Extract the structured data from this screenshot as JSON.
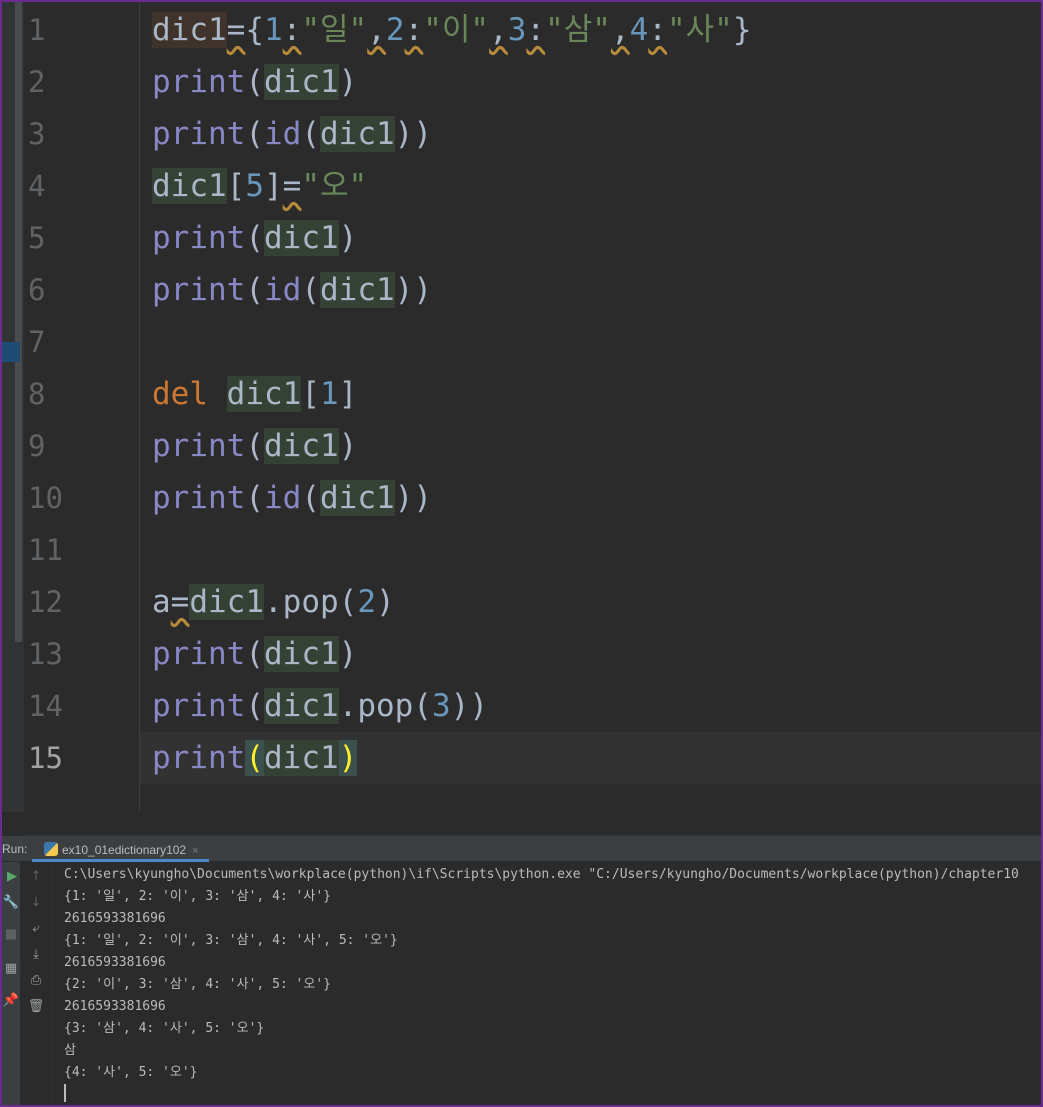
{
  "editor": {
    "line_numbers": [
      "1",
      "2",
      "3",
      "4",
      "5",
      "6",
      "7",
      "8",
      "9",
      "10",
      "11",
      "12",
      "13",
      "14",
      "15"
    ],
    "current_line": "15",
    "lines": [
      {
        "segments": [
          [
            "hl-def",
            "dic1"
          ],
          [
            "warn",
            "="
          ],
          [
            "",
            "{"
          ],
          [
            "num",
            "1"
          ],
          [
            "warn",
            ":"
          ],
          [
            "str",
            "\"일\""
          ],
          [
            "warn",
            ","
          ],
          [
            "num",
            "2"
          ],
          [
            "warn",
            ":"
          ],
          [
            "str",
            "\"이\""
          ],
          [
            "warn",
            ","
          ],
          [
            "num",
            "3"
          ],
          [
            "warn",
            ":"
          ],
          [
            "str",
            "\"삼\""
          ],
          [
            "warn",
            ","
          ],
          [
            "num",
            "4"
          ],
          [
            "warn",
            ":"
          ],
          [
            "str",
            "\"사\""
          ],
          [
            "",
            "}"
          ]
        ]
      },
      {
        "segments": [
          [
            "fn",
            "print"
          ],
          [
            "",
            "("
          ],
          [
            "hl-var",
            "dic1"
          ],
          [
            "",
            ")"
          ]
        ]
      },
      {
        "segments": [
          [
            "fn",
            "print"
          ],
          [
            "",
            "("
          ],
          [
            "fn",
            "id"
          ],
          [
            "",
            "("
          ],
          [
            "hl-var",
            "dic1"
          ],
          [
            "",
            "))"
          ]
        ]
      },
      {
        "segments": [
          [
            "hl-var",
            "dic1"
          ],
          [
            "",
            "["
          ],
          [
            "num",
            "5"
          ],
          [
            "",
            "]"
          ],
          [
            "warn",
            "="
          ],
          [
            "str",
            "\"오\""
          ]
        ]
      },
      {
        "segments": [
          [
            "fn",
            "print"
          ],
          [
            "",
            "("
          ],
          [
            "hl-var",
            "dic1"
          ],
          [
            "",
            ")"
          ]
        ]
      },
      {
        "segments": [
          [
            "fn",
            "print"
          ],
          [
            "",
            "("
          ],
          [
            "fn",
            "id"
          ],
          [
            "",
            "("
          ],
          [
            "hl-var",
            "dic1"
          ],
          [
            "",
            "))"
          ]
        ]
      },
      {
        "segments": []
      },
      {
        "segments": [
          [
            "kw",
            "del"
          ],
          [
            "",
            " "
          ],
          [
            "hl-var",
            "dic1"
          ],
          [
            "",
            "["
          ],
          [
            "num",
            "1"
          ],
          [
            "",
            "]"
          ]
        ]
      },
      {
        "segments": [
          [
            "fn",
            "print"
          ],
          [
            "",
            "("
          ],
          [
            "hl-var",
            "dic1"
          ],
          [
            "",
            ")"
          ]
        ]
      },
      {
        "segments": [
          [
            "fn",
            "print"
          ],
          [
            "",
            "("
          ],
          [
            "fn",
            "id"
          ],
          [
            "",
            "("
          ],
          [
            "hl-var",
            "dic1"
          ],
          [
            "",
            "))"
          ]
        ]
      },
      {
        "segments": []
      },
      {
        "segments": [
          [
            "",
            "a"
          ],
          [
            "warn",
            "="
          ],
          [
            "hl-var",
            "dic1"
          ],
          [
            "",
            ".pop("
          ],
          [
            "num",
            "2"
          ],
          [
            "",
            ")"
          ]
        ]
      },
      {
        "segments": [
          [
            "fn",
            "print"
          ],
          [
            "",
            "("
          ],
          [
            "hl-var",
            "dic1"
          ],
          [
            "",
            ")"
          ]
        ]
      },
      {
        "segments": [
          [
            "fn",
            "print"
          ],
          [
            "",
            "("
          ],
          [
            "hl-var",
            "dic1"
          ],
          [
            "",
            ".pop("
          ],
          [
            "num",
            "3"
          ],
          [
            "",
            "))"
          ]
        ]
      },
      {
        "segments": [
          [
            "fn",
            "print"
          ],
          [
            "brace-match",
            "("
          ],
          [
            "hl-var",
            "dic1"
          ],
          [
            "brace-match",
            ")"
          ]
        ]
      }
    ]
  },
  "run": {
    "label": "Run:",
    "tab_name": "ex10_01edictionary102",
    "tab_close": "×",
    "output": [
      "C:\\Users\\kyungho\\Documents\\workplace(python)\\if\\Scripts\\python.exe \"C:/Users/kyungho/Documents/workplace(python)/chapter10",
      "{1: '일', 2: '이', 3: '삼', 4: '사'}",
      "2616593381696",
      "{1: '일', 2: '이', 3: '삼', 4: '사', 5: '오'}",
      "2616593381696",
      "{2: '이', 3: '삼', 4: '사', 5: '오'}",
      "2616593381696",
      "{3: '삼', 4: '사', 5: '오'}",
      "삼",
      "{4: '사', 5: '오'}"
    ]
  },
  "icons": {
    "run": "▶",
    "wrench": "🔧",
    "stop": "■",
    "layout": "▦",
    "pin": "📌",
    "up": "↑",
    "down": "↓",
    "soft_wrap": "⤶",
    "scroll_end": "⤓",
    "print": "⎙",
    "trash": "🗑"
  }
}
